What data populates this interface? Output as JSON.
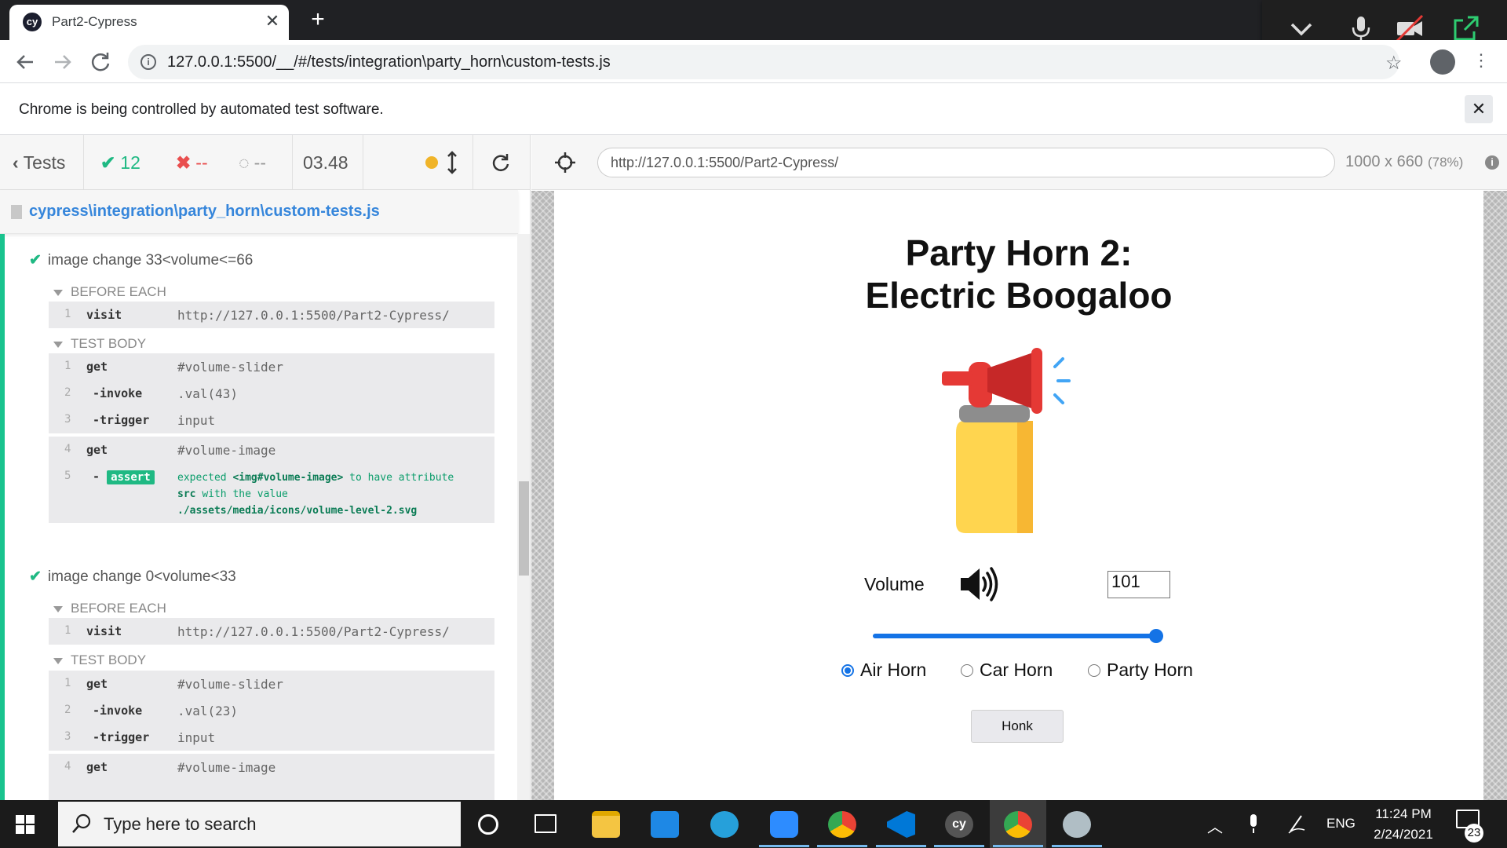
{
  "browser": {
    "tab_title": "Part2-Cypress",
    "tab_favicon": "cy",
    "address": "127.0.0.1:5500/__/#/tests/integration\\party_horn\\custom-tests.js",
    "infobar_text": "Chrome is being controlled by automated test software."
  },
  "reporter": {
    "tests_label": "Tests",
    "passed_count": "12",
    "failed_count": "--",
    "pending_count": "--",
    "duration": "03.48",
    "spec_file": "cypress\\integration\\party_horn\\custom-tests.js",
    "tests": [
      {
        "title": "image change 33<volume<=66",
        "before_each_label": "BEFORE EACH",
        "before_each": [
          {
            "num": "1",
            "name": "visit",
            "message": "http://127.0.0.1:5500/Part2-Cypress/"
          }
        ],
        "body_label": "TEST BODY",
        "body": [
          {
            "num": "1",
            "name": "get",
            "message": "#volume-slider"
          },
          {
            "num": "2",
            "name": "-invoke",
            "message": ".val(43)"
          },
          {
            "num": "3",
            "name": "-trigger",
            "message": "input"
          },
          {
            "num": "4",
            "name": "get",
            "message": "#volume-image"
          },
          {
            "num": "5",
            "name": "assert",
            "message_1": "expected",
            "message_2": "<img#volume-image>",
            "message_3": "to have attribute",
            "message_4": "src",
            "message_5": "with the value",
            "message_6": "./assets/media/icons/volume-level-2.svg"
          }
        ]
      },
      {
        "title": "image change 0<volume<33",
        "before_each_label": "BEFORE EACH",
        "before_each": [
          {
            "num": "1",
            "name": "visit",
            "message": "http://127.0.0.1:5500/Part2-Cypress/"
          }
        ],
        "body_label": "TEST BODY",
        "body": [
          {
            "num": "1",
            "name": "get",
            "message": "#volume-slider"
          },
          {
            "num": "2",
            "name": "-invoke",
            "message": ".val(23)"
          },
          {
            "num": "3",
            "name": "-trigger",
            "message": "input"
          },
          {
            "num": "4",
            "name": "get",
            "message": "#volume-image"
          }
        ]
      }
    ]
  },
  "aut": {
    "url": "http://127.0.0.1:5500/Part2-Cypress/",
    "viewport": "1000 x 660",
    "scale": "(78%)"
  },
  "app": {
    "title_line1": "Party Horn 2:",
    "title_line2": "Electric Boogaloo",
    "volume_label": "Volume",
    "volume_value": "101",
    "slider_level": 1.0,
    "sounds": [
      "Air Horn",
      "Car Horn",
      "Party Horn"
    ],
    "selected_sound": "Air Horn",
    "honk_label": "Honk"
  },
  "taskbar": {
    "search_placeholder": "Type here to search",
    "language": "ENG",
    "time": "11:24 PM",
    "date": "2/24/2021",
    "notification_count": "23",
    "apps": [
      "task-view-icon",
      "file-explorer-icon",
      "mail-icon",
      "edge-icon",
      "zoom-icon",
      "chrome-icon",
      "vscode-icon",
      "cypress-icon",
      "chrome-icon",
      "bear-icon"
    ]
  },
  "colors": {
    "pass_green": "#1fb983",
    "spec_blue": "#3686db",
    "slider_blue": "#1473e6",
    "horn_red": "#e53935",
    "horn_yellow": "#ffd54f"
  }
}
